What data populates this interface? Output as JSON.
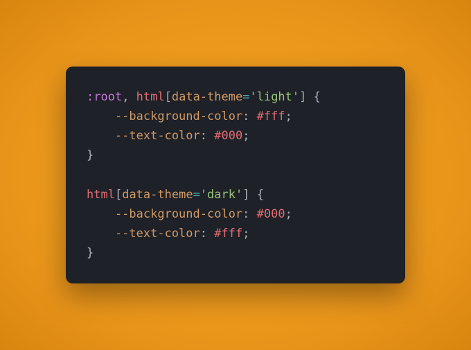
{
  "code": {
    "line1": {
      "pseudo": ":root",
      "comma": ", ",
      "tag": "html",
      "lbracket": "[",
      "attr": "data-theme",
      "eq": "=",
      "str": "'light'",
      "rbracket": "]",
      "space_open": " {"
    },
    "line2": {
      "var": "--background-color",
      "colon": ": ",
      "val": "#fff",
      "semi": ";"
    },
    "line3": {
      "var": "--text-color",
      "colon": ": ",
      "val": "#000",
      "semi": ";"
    },
    "line4": {
      "close": "}"
    },
    "line6": {
      "tag": "html",
      "lbracket": "[",
      "attr": "data-theme",
      "eq": "=",
      "str": "'dark'",
      "rbracket": "]",
      "space_open": " {"
    },
    "line7": {
      "var": "--background-color",
      "colon": ": ",
      "val": "#000",
      "semi": ";"
    },
    "line8": {
      "var": "--text-color",
      "colon": ": ",
      "val": "#fff",
      "semi": ";"
    },
    "line9": {
      "close": "}"
    }
  }
}
